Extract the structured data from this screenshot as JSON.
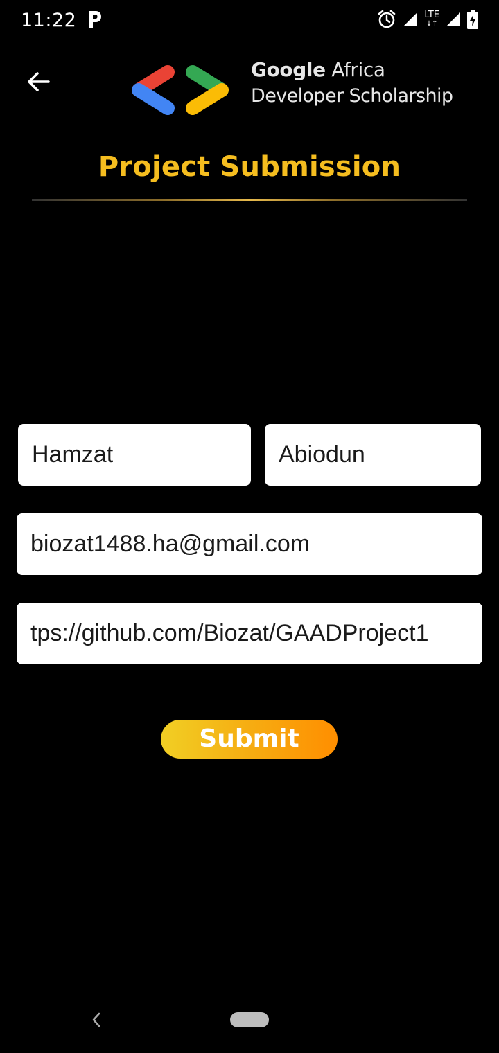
{
  "status_bar": {
    "time": "11:22",
    "network": "LTE",
    "icons": [
      "parking-notification-icon",
      "alarm-icon",
      "signal-icon",
      "lte-icon",
      "signal-icon",
      "battery-charging-icon"
    ]
  },
  "header": {
    "back_icon": "arrow-left-icon",
    "logo_line1_bold": "Google",
    "logo_line1_rest": " Africa",
    "logo_line2": "Developer Scholarship",
    "logo_colors": [
      "#ea4335",
      "#4285f4",
      "#34a853",
      "#fbbc05"
    ]
  },
  "page": {
    "title": "Project Submission",
    "title_color": "#f5bd1f"
  },
  "form": {
    "first_name": "Hamzat",
    "last_name": "Abiodun",
    "email": "biozat1488.ha@gmail.com",
    "project_link": "tps://github.com/Biozat/GAADProject1",
    "submit_label": "Submit"
  },
  "nav_bar": {
    "back_icon": "chevron-left-icon",
    "home_icon": "home-pill-icon"
  }
}
